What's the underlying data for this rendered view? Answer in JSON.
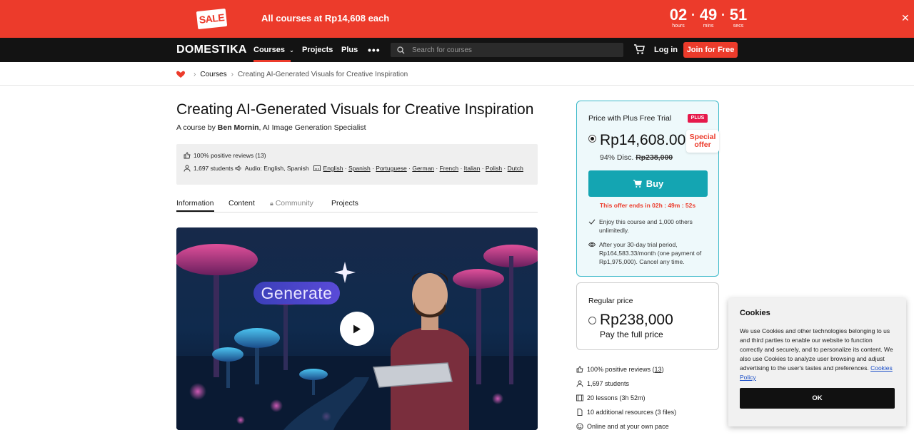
{
  "colors": {
    "brand_red": "#ec3b2b",
    "nav_bg": "#131313",
    "teal": "#14a5b2",
    "plus_pink": "#e6194b"
  },
  "promo": {
    "sale_badge": "SALE",
    "text": "All courses at Rp14,608 each",
    "countdown": {
      "hours": "02",
      "hours_label": "hours",
      "mins": "49",
      "mins_label": "mins",
      "secs": "51",
      "secs_label": "secs"
    },
    "close_icon": "close-icon"
  },
  "nav": {
    "logo": "DOMESTIKA",
    "courses": "Courses",
    "projects": "Projects",
    "plus": "Plus",
    "more": "•••",
    "search_placeholder": "Search for courses",
    "login": "Log in",
    "join": "Join for Free"
  },
  "breadcrumb": {
    "courses": "Courses",
    "current": "Creating AI-Generated Visuals for Creative Inspiration"
  },
  "course": {
    "title": "Creating AI-Generated Visuals for Creative Inspiration",
    "by_prefix": "A course by ",
    "author": "Ben Mornin",
    "author_suffix": ", AI Image Generation Specialist",
    "reviews": "100% positive reviews (13)",
    "students": "1,697 students",
    "audio": "Audio: English, Spanish",
    "subtitles": [
      "English",
      "Spanish",
      "Portuguese",
      "German",
      "French",
      "Italian",
      "Polish",
      "Dutch"
    ],
    "video_overlay_text": "Generate"
  },
  "tabs": [
    {
      "label": "Information"
    },
    {
      "label": "Content"
    },
    {
      "label": "Community"
    },
    {
      "label": "Projects"
    }
  ],
  "plus_card": {
    "title": "Price with Plus Free Trial",
    "badge": "PLUS",
    "price": "Rp14,608.00",
    "special_offer": "Special offer",
    "discount": "94% Disc.",
    "old_price": "Rp238,000",
    "buy": "Buy",
    "offer_ends": "This offer ends in 02h : 49m : 52s",
    "perk1": "Enjoy this course and 1,000 others unlimitedly.",
    "perk2": "After your 30-day trial period, Rp164,583.33/month (one payment of Rp1,975,000). Cancel any time."
  },
  "regular_card": {
    "title": "Regular price",
    "price": "Rp238,000",
    "sub": "Pay the full price"
  },
  "side_stats": {
    "reviews_prefix": "100% positive reviews (",
    "reviews_count": "13",
    "reviews_suffix": ")",
    "students": "1,697 students",
    "lessons": "20 lessons (3h 52m)",
    "resources": "10 additional resources (3 files)",
    "pace": "Online and at your own pace"
  },
  "cookies": {
    "title": "Cookies",
    "text": "We use Cookies and other technologies belonging to us and third parties to enable our website to function correctly and securely, and to personalize its content. We also use Cookies to analyze user browsing and adjust advertising to the user's tastes and preferences.",
    "link": "Cookies Policy",
    "ok": "OK"
  }
}
